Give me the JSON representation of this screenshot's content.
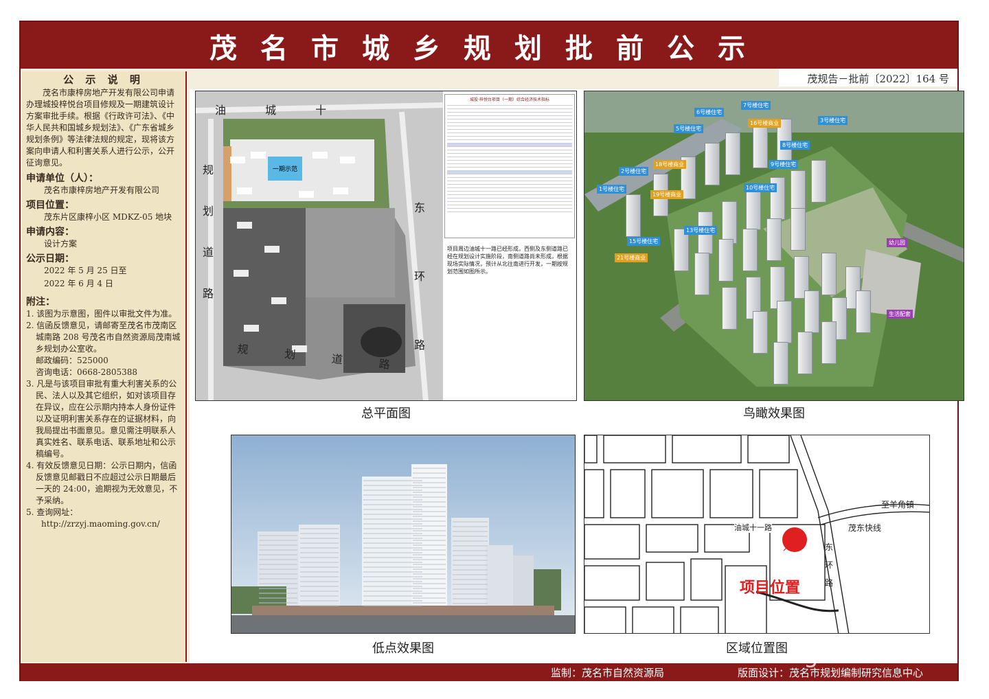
{
  "header": {
    "title": "茂名市城乡规划批前公示",
    "doc_number": "茂规告－批前〔2022〕164 号"
  },
  "sidebar": {
    "heading": "公 示 说 明",
    "intro": "茂名市康梓房地产开发有限公司申请办理城投梓悦台项目修规及一期建筑设计方案审批手续。根据《行政许可法》、《中华人民共和国城乡规划法》、《广东省城乡规划条例》等法律法规的规定，现将该方案向申请人和利害关系人进行公示，公开征询意见。",
    "applicant_label": "申请单位（人）：",
    "applicant": "茂名市康梓房地产开发有限公司",
    "location_label": "项目位置：",
    "location": "茂东片区康梓小区 MDKZ-05 地块",
    "content_label": "申请内容：",
    "content": "设计方案",
    "date_label": "公示日期：",
    "date_start": "2022 年 5 月 25 日至",
    "date_end": "2022 年 6 月 4 日",
    "notes_label": "附注：",
    "notes": [
      "1. 该图为示意图，图件以审批文件为准。",
      "2. 信函反馈意见，请邮寄至茂名市茂南区城南路 208 号茂名市自然资源局茂南城乡规划办公室收。",
      "3. 凡是与该项目审批有重大利害关系的公民、法人以及其它组织，如对该项目存在异议，应在公示期内持本人身份证件以及证明利害关系存在的证据材料，向我局提出书面意见。意见需注明联系人真实姓名、联系电话、联系地址和公示稿编号。",
      "4. 有效反馈意见日期：公示日期内，信函反馈意见邮戳日不应超过公示日期最后一天的 24:00，逾期视为无效意见，不予采纳。",
      "5. 查询网址："
    ],
    "postcode": "邮政编码：525000",
    "phone": "咨询电话：0668-2805388",
    "website": "http://zrzyj.maoming.gov.cn/"
  },
  "panels": {
    "site_plan": {
      "caption": "总平面图",
      "road_west": "规 划 道 路",
      "road_north": "油 城 十",
      "road_east": "东 环 路",
      "road_south": "规 划 道 路",
      "pool_label": "一期示范",
      "table_title": "城投·梓悦台项目（一期）综合经济技术指标",
      "note": "项目周边油城十一路已经形成，西侧及东侧道路已经在规划设计实施阶段，南侧道路尚未形成，根据现场实际情况，预计从北往南进行开发，一期按规划范围如图所示。"
    },
    "aerial": {
      "caption": "鸟瞰效果图",
      "labels": [
        "7号楼住宅",
        "6号楼住宅",
        "5号楼住宅",
        "3号楼住宅",
        "16号楼商业",
        "8号楼住宅",
        "2号楼住宅",
        "18号楼商业",
        "9号楼住宅",
        "1号楼住宅",
        "19号楼商业",
        "10号楼住宅",
        "13号楼住宅",
        "15号楼住宅",
        "21号楼商业",
        "幼儿园",
        "生活配套"
      ]
    },
    "low_view": {
      "caption": "低点效果图"
    },
    "location_map": {
      "caption": "区域位置图",
      "to_town": "至羊角镇",
      "road_youcheng": "油城十一路",
      "road_express": "茂东快线",
      "road_east_ring": "东 环 路",
      "project_label": "项目位置"
    }
  },
  "footer": {
    "supervisor": "监制：茂名市自然资源局",
    "designer": "版面设计：茂名市规划编制研究信息中心"
  },
  "watermark": "gdmm.com",
  "colors": {
    "banner": "#8a1a1a",
    "sidebar": "#efe4c3",
    "marker": "#e02020"
  }
}
